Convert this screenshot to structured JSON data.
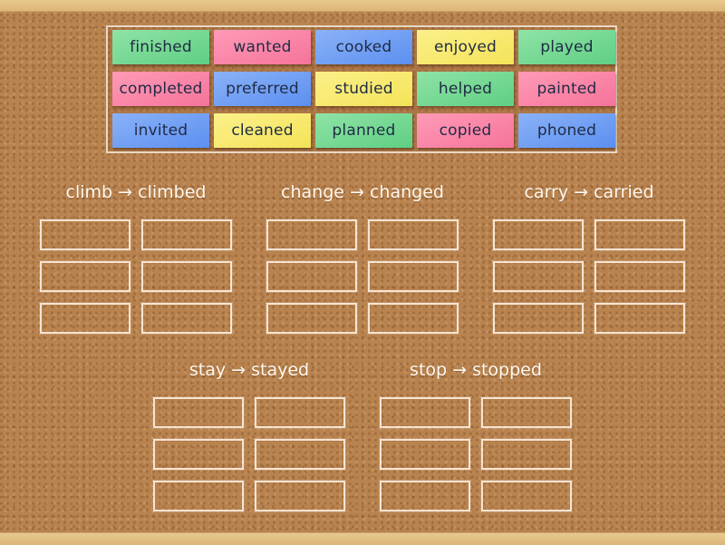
{
  "activity": {
    "type": "group-sort",
    "word_bank": [
      {
        "word": "finished",
        "color": "green"
      },
      {
        "word": "wanted",
        "color": "pink"
      },
      {
        "word": "cooked",
        "color": "blue"
      },
      {
        "word": "enjoyed",
        "color": "yellow"
      },
      {
        "word": "played",
        "color": "green"
      },
      {
        "word": "completed",
        "color": "pink"
      },
      {
        "word": "preferred",
        "color": "blue"
      },
      {
        "word": "studied",
        "color": "yellow"
      },
      {
        "word": "helped",
        "color": "green"
      },
      {
        "word": "painted",
        "color": "pink"
      },
      {
        "word": "invited",
        "color": "blue"
      },
      {
        "word": "cleaned",
        "color": "yellow"
      },
      {
        "word": "planned",
        "color": "green"
      },
      {
        "word": "copied",
        "color": "pink"
      },
      {
        "word": "phoned",
        "color": "blue"
      }
    ],
    "groups": [
      {
        "heading": "climb → climbed",
        "slots": 6,
        "filled": 0
      },
      {
        "heading": "change → changed",
        "slots": 6,
        "filled": 0
      },
      {
        "heading": "carry → carried",
        "slots": 6,
        "filled": 0
      },
      {
        "heading": "stay → stayed",
        "slots": 6,
        "filled": 0
      },
      {
        "heading": "stop → stopped",
        "slots": 6,
        "filled": 0
      }
    ]
  },
  "colors": {
    "green": "#6fd890",
    "pink": "#f985a6",
    "blue": "#6f9ef3",
    "yellow": "#f7e96c",
    "cork": "#b8834f",
    "wood": "#e3c085",
    "text": "#1f2a44",
    "heading_text": "#fff8ee"
  }
}
